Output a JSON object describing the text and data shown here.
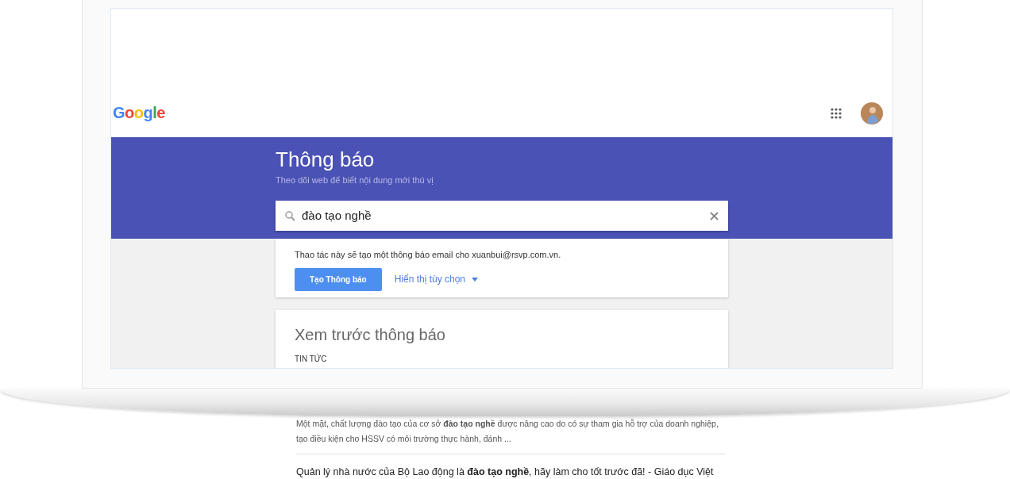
{
  "header": {
    "logo": "Google"
  },
  "banner": {
    "title": "Thông báo",
    "subtitle": "Theo dõi web để biết nội dung mới thú vị"
  },
  "search": {
    "value": "đào tạo nghề"
  },
  "create_card": {
    "note": "Thao tác này sẽ tạo một thông báo email cho xuanbui@rsvp.com.vn.",
    "button": "Tạo Thông báo",
    "options_link": "Hiển thị tùy chọn"
  },
  "preview": {
    "title": "Xem trước thông báo",
    "section": "TIN TỨC",
    "results": [
      {
        "snippet": "Một mặt, chất lượng đào tạo của cơ sở **đào tạo nghề** được nâng cao do có sự tham gia hỗ trợ của doanh nghiệp, tạo điều kiện cho HSSV có môi trường thực hành, đánh ..."
      },
      {
        "title": "Quản lý nhà nước của Bộ Lao động là **đào tạo nghề**, hãy làm cho tốt trước đã! - Giáo dục Việt"
      }
    ]
  }
}
